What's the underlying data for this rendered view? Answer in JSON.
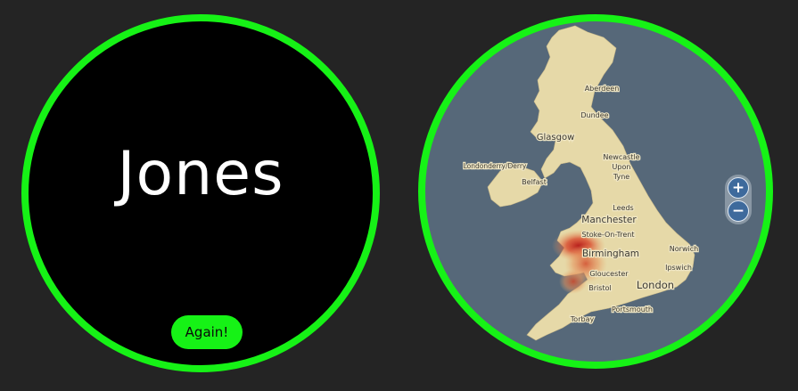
{
  "name_panel": {
    "surname": "Jones",
    "again_label": "Again!"
  },
  "map_panel": {
    "cities": [
      {
        "label": "Aberdeen"
      },
      {
        "label": "Dundee"
      },
      {
        "label": "Glasgow"
      },
      {
        "label": "Londonderry/Derry"
      },
      {
        "label": "Belfast"
      },
      {
        "label": "Newcastle"
      },
      {
        "label": "Upon"
      },
      {
        "label": "Tyne"
      },
      {
        "label": "Leeds"
      },
      {
        "label": "Manchester"
      },
      {
        "label": "Stoke-On-Trent"
      },
      {
        "label": "Birmingham"
      },
      {
        "label": "Norwich"
      },
      {
        "label": "Ipswich"
      },
      {
        "label": "Gloucester"
      },
      {
        "label": "Bristol"
      },
      {
        "label": "London"
      },
      {
        "label": "Portsmouth"
      },
      {
        "label": "Torbay"
      }
    ],
    "zoom_in_label": "+",
    "zoom_out_label": "−"
  },
  "colors": {
    "accent": "#16f216",
    "page_background": "#242424",
    "name_background": "#000000",
    "sea": "#566879",
    "land": "#e6d9a8"
  }
}
